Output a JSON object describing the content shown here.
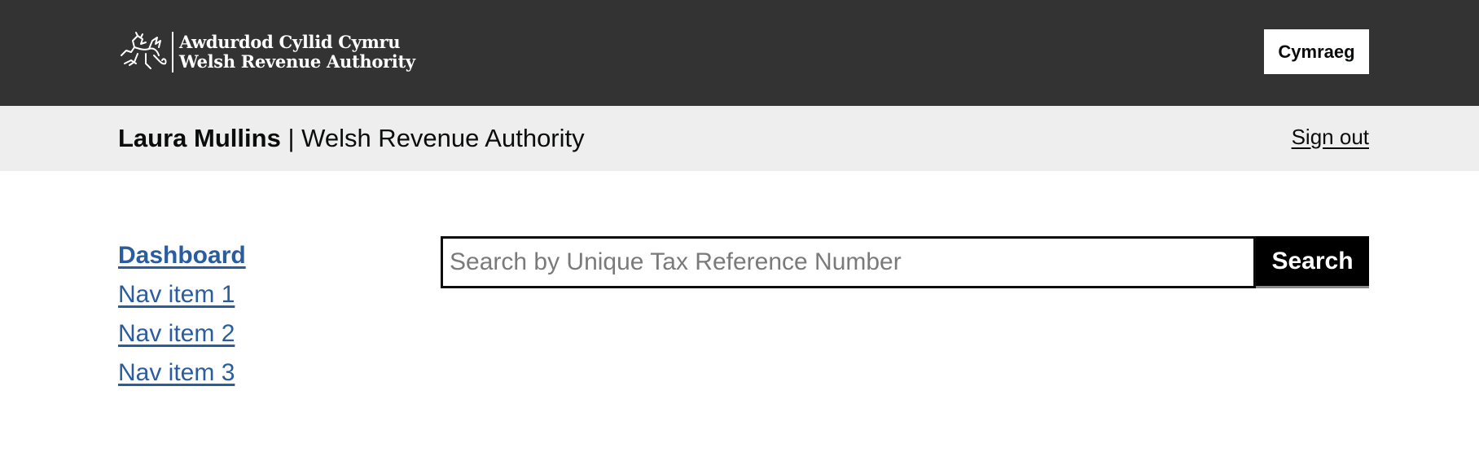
{
  "header": {
    "logo": {
      "line1": "Awdurdod Cyllid Cymru",
      "line2": "Welsh Revenue Authority"
    },
    "language_button": "Cymraeg"
  },
  "account_bar": {
    "user_name": "Laura Mullins",
    "separator": "|",
    "organisation": "Welsh Revenue Authority",
    "sign_out": "Sign out"
  },
  "nav": {
    "items": [
      {
        "label": "Dashboard",
        "active": true
      },
      {
        "label": "Nav item 1",
        "active": false
      },
      {
        "label": "Nav item 2",
        "active": false
      },
      {
        "label": "Nav item 3",
        "active": false
      }
    ]
  },
  "search": {
    "placeholder": "Search by Unique Tax Reference Number",
    "value": "",
    "button_label": "Search"
  },
  "colors": {
    "header_bg": "#333333",
    "subheader_bg": "#eeeeee",
    "link": "#2a5d9f",
    "text": "#0b0c0c",
    "button_bg": "#000000"
  },
  "icons": {
    "logo": "welsh-dragon-icon"
  }
}
